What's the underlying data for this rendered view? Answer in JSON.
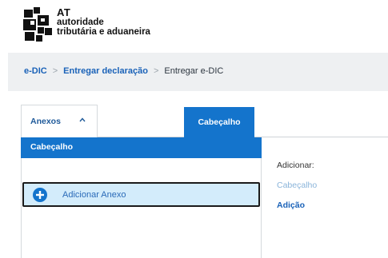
{
  "header": {
    "brand_at": "AT",
    "brand_line1": "autoridade",
    "brand_line2": "tributária e aduaneira",
    "logo_icon": "at-logo-icon"
  },
  "breadcrumb": {
    "items": [
      "e-DIC",
      "Entregar declaração",
      "Entregar e-DIC"
    ],
    "separator": ">"
  },
  "tabs": {
    "anexos_label": "Anexos",
    "anexos_icon": "chevron-up-icon",
    "cabecalho_label": "Cabeçalho"
  },
  "sidebar": {
    "selected_item": "Cabeçalho",
    "add_annex_label": "Adicionar Anexo",
    "add_icon": "plus-circle-icon"
  },
  "detail": {
    "title": "Adicionar:",
    "subtitle": "Cabeçalho",
    "action": "Adição"
  },
  "colors": {
    "accent_blue": "#1474cc",
    "link_blue": "#1a62b8",
    "highlight_bg": "#d3ecfb",
    "breadcrumb_bg": "#eef0f2"
  }
}
